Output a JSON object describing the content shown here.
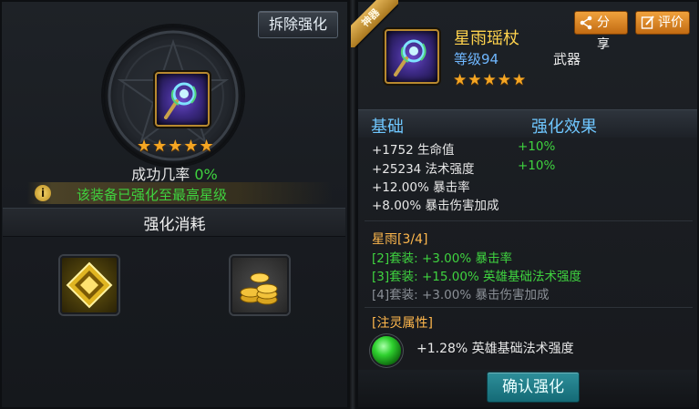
{
  "left_panel": {
    "dismantle_button": "拆除强化",
    "success_rate_label": "成功几率",
    "success_rate_value": "0%",
    "stars": "★★★★★",
    "info_message": "该装备已强化至最高星级",
    "info_icon": "i",
    "cost_title": "强化消耗",
    "cost_items": [
      "enhance-crystal-icon",
      "gold-coins-icon"
    ]
  },
  "item": {
    "ribbon": "神器",
    "name": "星雨瑶杖",
    "level": "等级94",
    "type": "武器",
    "stars": "★★★★★",
    "icon": "staff-icon"
  },
  "actions": {
    "share": "分享",
    "review": "评价",
    "share_icon": "share-icon",
    "review_icon": "edit-icon"
  },
  "stats": {
    "base_header": "基础",
    "effect_header": "强化效果",
    "lines": [
      {
        "text": "+1752 生命值",
        "effect": "+10%"
      },
      {
        "text": "+25234 法术强度",
        "effect": "+10%"
      },
      {
        "text": "+12.00% 暴击率",
        "effect": ""
      },
      {
        "text": "+8.00% 暴击伤害加成",
        "effect": ""
      }
    ]
  },
  "set_bonus": {
    "title": "星雨[3/4]",
    "lines": [
      {
        "text": "[2]套装: +3.00% 暴击率",
        "active": true
      },
      {
        "text": "[3]套装: +15.00% 英雄基础法术强度",
        "active": true
      },
      {
        "text": "[4]套装: +3.00% 暴击伤害加成",
        "active": false
      }
    ]
  },
  "spirit": {
    "title": "[注灵属性]",
    "text": "+1.28% 英雄基础法术强度"
  },
  "confirm_button": "确认强化",
  "colors": {
    "gold": "#ffd34d",
    "green": "#3fd33f",
    "blue": "#6fc7ff",
    "orange": "#f0a23d",
    "teal": "#2e8f9a"
  }
}
